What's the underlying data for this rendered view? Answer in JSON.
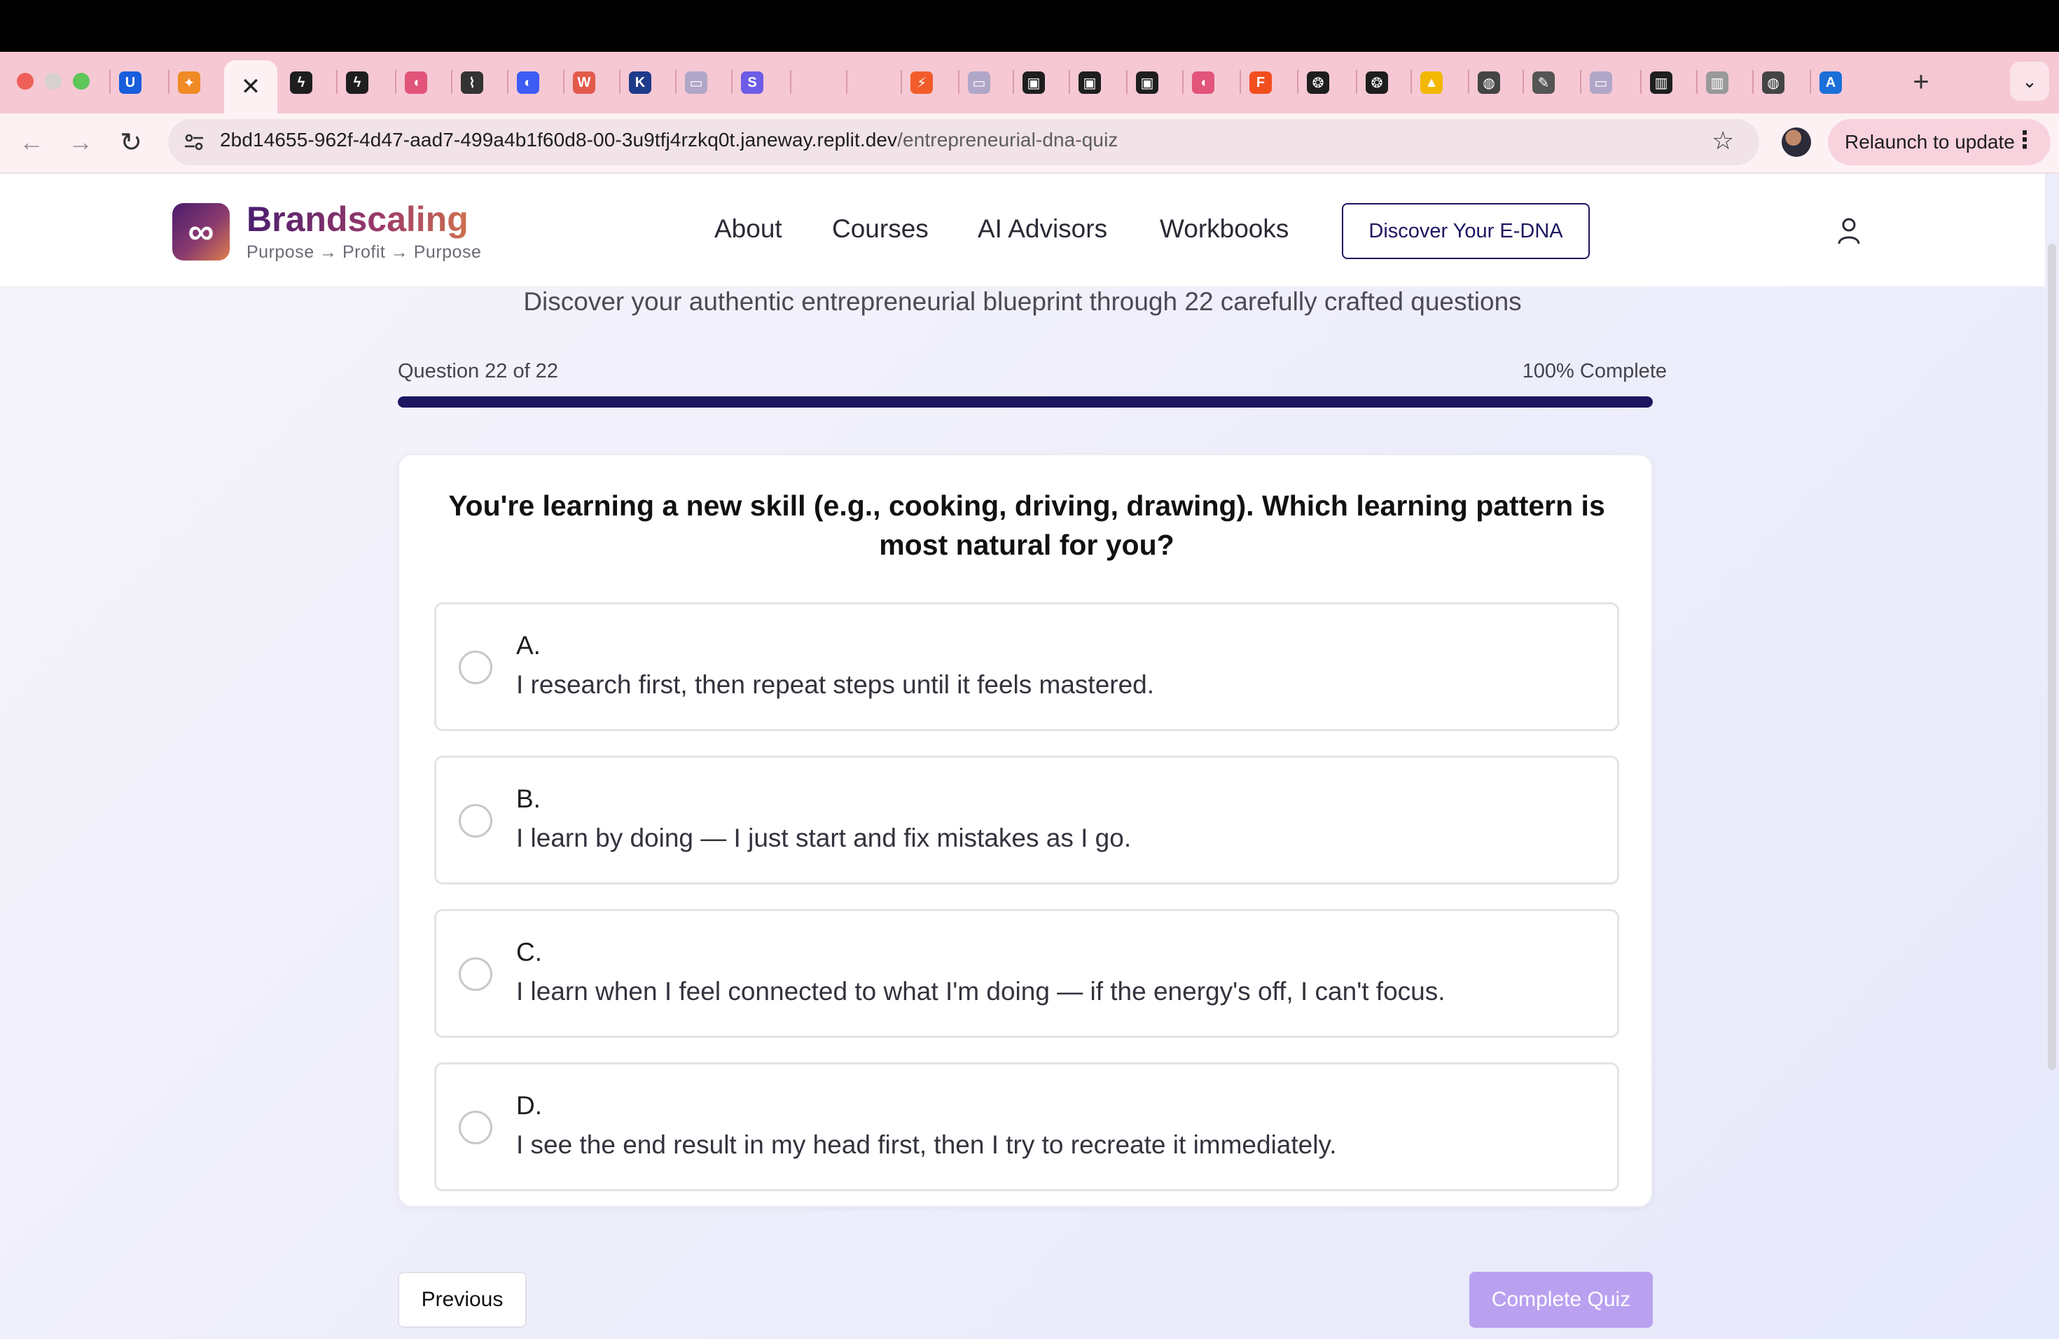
{
  "browser": {
    "active_tab_close": "✕",
    "new_tab": "+",
    "tab_menu": "⌄",
    "back": "←",
    "forward": "→",
    "reload": "↻",
    "url_host": "2bd14655-962f-4d47-aad7-499a4b1f60d8-00-3u9tfj4rzkq0t.janeway.replit.dev",
    "url_path": "/entrepreneurial-dna-quiz",
    "bookmark": "☆",
    "relaunch_label": "Relaunch to update",
    "menu_dots": "⋮",
    "tabs": [
      {
        "icon": "bitwarden-icon",
        "glyph": "U",
        "color": "#175ddc"
      },
      {
        "icon": "colorful-grid-icon",
        "glyph": "✦",
        "color": "#f08a24"
      },
      {
        "icon": "supabase-icon",
        "glyph": "ϟ",
        "color": "#1e1e1e"
      },
      {
        "icon": "supabase-icon",
        "glyph": "ϟ",
        "color": "#1e1e1e"
      },
      {
        "icon": "folder-gradient-icon",
        "glyph": "◖",
        "color": "#e2547a"
      },
      {
        "icon": "messenger-icon",
        "glyph": "⌇",
        "color": "#333333"
      },
      {
        "icon": "half-circle-icon",
        "glyph": "◐",
        "color": "#3d5cf5"
      },
      {
        "icon": "webflow-icon",
        "glyph": "W",
        "color": "#e25a4a"
      },
      {
        "icon": "k-logo-icon",
        "glyph": "K",
        "color": "#1e3a8a"
      },
      {
        "icon": "generic-page-icon",
        "glyph": "▭",
        "color": "#b0a7c8"
      },
      {
        "icon": "s-logo-icon",
        "glyph": "S",
        "color": "#6c5ce7"
      },
      {
        "icon": "blank-tab-icon",
        "glyph": "",
        "color": "#f5c8d4"
      },
      {
        "icon": "blank-tab-icon",
        "glyph": "",
        "color": "#f5c8d4"
      },
      {
        "icon": "bolt-icon",
        "glyph": "⚡",
        "color": "#f25c2a"
      },
      {
        "icon": "generic-page-icon",
        "glyph": "▭",
        "color": "#b0a7c8"
      },
      {
        "icon": "monitor-icon",
        "glyph": "▣",
        "color": "#1e1e1e"
      },
      {
        "icon": "monitor-icon",
        "glyph": "▣",
        "color": "#1e1e1e"
      },
      {
        "icon": "monitor-icon",
        "glyph": "▣",
        "color": "#1e1e1e"
      },
      {
        "icon": "folder-gradient-icon",
        "glyph": "◖",
        "color": "#e2547a"
      },
      {
        "icon": "figma-icon",
        "glyph": "F",
        "color": "#f24e1e"
      },
      {
        "icon": "openai-icon",
        "glyph": "❂",
        "color": "#1e1e1e"
      },
      {
        "icon": "openai-icon",
        "glyph": "❂",
        "color": "#1e1e1e"
      },
      {
        "icon": "triangle-logo-icon",
        "glyph": "▲",
        "color": "#f2b800"
      },
      {
        "icon": "globe-icon",
        "glyph": "◍",
        "color": "#444444"
      },
      {
        "icon": "pen-icon",
        "glyph": "✎",
        "color": "#555555"
      },
      {
        "icon": "generic-page-icon",
        "glyph": "▭",
        "color": "#b0a7c8"
      },
      {
        "icon": "chart-icon",
        "glyph": "▥",
        "color": "#1e1e1e"
      },
      {
        "icon": "generic-page-icon",
        "glyph": "▥",
        "color": "#999999"
      },
      {
        "icon": "globe-icon",
        "glyph": "◍",
        "color": "#444444"
      },
      {
        "icon": "azure-icon",
        "glyph": "A",
        "color": "#1a6fd8"
      }
    ]
  },
  "site": {
    "logo_glyph": "∞",
    "brand_name": "Brandscaling",
    "tagline": "Purpose → Profit → Purpose",
    "nav": [
      "About",
      "Courses",
      "AI Advisors",
      "Workbooks"
    ],
    "cta_label": "Discover Your E-DNA"
  },
  "quiz": {
    "subtitle": "Discover your authentic entrepreneurial blueprint through 22 carefully crafted questions",
    "progress_label": "Question 22 of 22",
    "progress_percent_label": "100% Complete",
    "progress_fraction": 1.0,
    "question": "You're learning a new skill (e.g., cooking, driving, drawing). Which learning pattern is most natural for you?",
    "options": [
      {
        "letter": "A.",
        "text": "I research first, then repeat steps until it feels mastered."
      },
      {
        "letter": "B.",
        "text": "I learn by doing — I just start and fix mistakes as I go."
      },
      {
        "letter": "C.",
        "text": "I learn when I feel connected to what I'm doing — if the energy's off, I can't focus."
      },
      {
        "letter": "D.",
        "text": "I see the end result in my head first, then I try to recreate it immediately."
      }
    ],
    "previous_label": "Previous",
    "complete_label": "Complete Quiz"
  },
  "colors": {
    "brand_dark": "#1c1660",
    "complete_button": "#b9a1f0",
    "tab_strip": "#f5c8d4"
  }
}
